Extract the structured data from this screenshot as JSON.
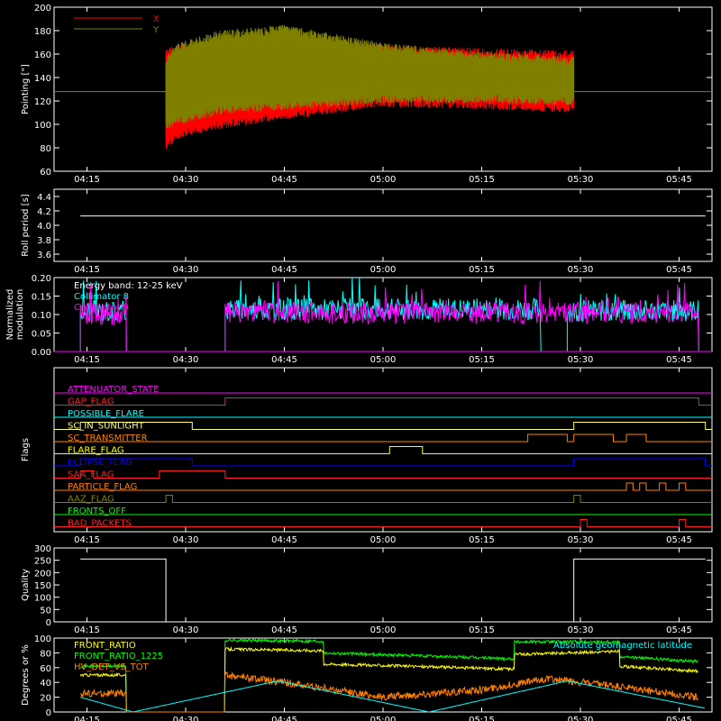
{
  "time_axis": {
    "ticks": [
      "04:15",
      "04:30",
      "04:45",
      "05:00",
      "05:15",
      "05:30",
      "05:45"
    ],
    "start_min": 250,
    "end_min": 350
  },
  "chart_data": [
    {
      "id": "pointing",
      "type": "line",
      "ylabel": "Pointing [\"]",
      "ylim": [
        60,
        200
      ],
      "yticks": [
        "60",
        "80",
        "100",
        "120",
        "140",
        "160",
        "180",
        "200"
      ],
      "legend": [
        {
          "name": "X",
          "color": "#ff0000"
        },
        {
          "name": "Y",
          "color": "#808000"
        }
      ],
      "series": [
        {
          "name": "X",
          "color": "#ff0000",
          "x": [
            "04:27",
            "04:29",
            "04:35",
            "04:45",
            "05:00",
            "05:15",
            "05:29"
          ],
          "upper": [
            165,
            168,
            172,
            172,
            168,
            165,
            163
          ],
          "lower": [
            78,
            88,
            96,
            104,
            115,
            113,
            110
          ]
        },
        {
          "name": "Y",
          "color": "#808000",
          "x": [
            "04:27",
            "04:29",
            "04:35",
            "04:45",
            "05:00",
            "05:15",
            "05:29"
          ],
          "upper": [
            160,
            170,
            180,
            185,
            170,
            162,
            158
          ],
          "lower": [
            95,
            100,
            108,
            112,
            118,
            118,
            116
          ]
        }
      ],
      "baseline": 128
    },
    {
      "id": "roll",
      "type": "line",
      "ylabel": "Roll period [s]",
      "ylim": [
        3.5,
        4.5
      ],
      "yticks": [
        "3.6",
        "3.8",
        "4.0",
        "4.2",
        "4.4"
      ],
      "series": [
        {
          "name": "",
          "color": "#ffffff",
          "x": [
            "04:14",
            "05:49"
          ],
          "y": [
            4.13,
            4.13
          ]
        }
      ]
    },
    {
      "id": "modulation",
      "type": "line",
      "ylabel": "Normalized modulation",
      "ylim": [
        0,
        0.2
      ],
      "yticks": [
        "0.00",
        "0.05",
        "0.10",
        "0.15",
        "0.20"
      ],
      "annotation": "Energy band: 12-25 keV",
      "legend": [
        {
          "name": "Collimator 8",
          "color": "#00ffff"
        },
        {
          "name": "Collimator 9",
          "color": "#ff00ff"
        }
      ],
      "series": [
        {
          "name": "Collimator 8",
          "color": "#00ffff",
          "segments": [
            [
              "04:14",
              "04:21",
              0.11
            ],
            [
              "04:36",
              "05:24",
              0.115
            ],
            [
              "05:28",
              "05:48",
              0.11
            ]
          ]
        },
        {
          "name": "Collimator 9",
          "color": "#ff00ff",
          "segments": [
            [
              "04:14",
              "04:21",
              0.1
            ],
            [
              "04:36",
              "05:48",
              0.105
            ]
          ]
        }
      ]
    },
    {
      "id": "flags",
      "type": "line",
      "ylabel": "Flags",
      "rows": [
        {
          "name": "ATTENUATOR_STATE",
          "color": "#ff00ff",
          "steps": []
        },
        {
          "name": "GAP_FLAG",
          "color": "#ff2020",
          "steps": [
            [
              "04:36",
              "05:48"
            ]
          ]
        },
        {
          "name": "POSSIBLE_FLARE",
          "color": "#00ffff",
          "steps": []
        },
        {
          "name": "SC_IN_SUNLIGHT",
          "color": "#ffff80",
          "steps": [
            [
              "04:14",
              "04:31"
            ],
            [
              "05:29",
              "05:49"
            ]
          ]
        },
        {
          "name": "SC_TRANSMITTER",
          "color": "#ff8000",
          "steps": [
            [
              "05:22",
              "05:28"
            ],
            [
              "05:29",
              "05:35"
            ],
            [
              "05:37",
              "05:40"
            ]
          ]
        },
        {
          "name": "FLARE_FLAG",
          "color": "#ffff00",
          "steps": [
            [
              "05:01",
              "05:06"
            ]
          ]
        },
        {
          "name": "ECLIPSE_FLAG",
          "color": "#0000ff",
          "steps": [
            [
              "04:14",
              "04:31"
            ],
            [
              "05:29",
              "05:49"
            ]
          ]
        },
        {
          "name": "SAA_FLAG",
          "color": "#ff2020",
          "steps": [
            [
              "04:14",
              "04:16"
            ],
            [
              "04:26",
              "04:36"
            ]
          ]
        },
        {
          "name": "PARTICLE_FLAG",
          "color": "#ff8000",
          "steps": [
            [
              "05:37",
              "05:38"
            ],
            [
              "05:39",
              "05:40"
            ],
            [
              "05:42",
              "05:43"
            ],
            [
              "05:45",
              "05:46"
            ]
          ]
        },
        {
          "name": "AAZ_FLAG",
          "color": "#808000",
          "steps": [
            [
              "04:27",
              "04:28"
            ],
            [
              "05:29",
              "05:30"
            ]
          ]
        },
        {
          "name": "FRONTS_OFF",
          "color": "#00ff00",
          "steps": []
        },
        {
          "name": "BAD_PACKETS",
          "color": "#ff2020",
          "steps": [
            [
              "05:30",
              "05:31"
            ],
            [
              "05:45",
              "05:46"
            ]
          ]
        }
      ]
    },
    {
      "id": "quality",
      "type": "line",
      "ylabel": "Quality",
      "ylim": [
        0,
        300
      ],
      "yticks": [
        "0",
        "50",
        "100",
        "150",
        "200",
        "250",
        "300"
      ],
      "series": [
        {
          "name": "",
          "color": "#ffffff",
          "x": [
            "04:14",
            "04:27",
            "04:27",
            "05:29",
            "05:29",
            "05:49"
          ],
          "y": [
            255,
            255,
            0,
            0,
            255,
            255
          ]
        }
      ]
    },
    {
      "id": "fronts",
      "type": "line",
      "ylabel": "Degrees or %",
      "ylim": [
        0,
        100
      ],
      "yticks": [
        "0",
        "20",
        "40",
        "60",
        "80",
        "100"
      ],
      "legend": [
        {
          "name": "FRONT_RATIO",
          "color": "#ffff00"
        },
        {
          "name": "FRONT_RATIO_1225",
          "color": "#00ff00"
        },
        {
          "name": "HV_DET_VS_TOT",
          "color": "#ff8000"
        },
        {
          "name": "Absolute geomagnetic latitude",
          "color": "#00ffff"
        }
      ],
      "series": [
        {
          "name": "FRONT_RATIO_1225",
          "color": "#00ff00",
          "x": [
            "04:14",
            "04:21",
            "04:21",
            "04:36",
            "04:36",
            "04:51",
            "04:51",
            "05:20",
            "05:20",
            "05:36",
            "05:36",
            "05:48",
            "05:48"
          ],
          "y": [
            62,
            62,
            0,
            0,
            97,
            96,
            80,
            72,
            95,
            95,
            75,
            68,
            0
          ]
        },
        {
          "name": "FRONT_RATIO",
          "color": "#ffff00",
          "x": [
            "04:14",
            "04:21",
            "04:21",
            "04:36",
            "04:36",
            "04:51",
            "04:51",
            "05:20",
            "05:20",
            "05:36",
            "05:36",
            "05:48",
            "05:48"
          ],
          "y": [
            50,
            50,
            0,
            0,
            85,
            83,
            65,
            58,
            78,
            82,
            62,
            55,
            0
          ]
        },
        {
          "name": "HV_DET_VS_TOT",
          "color": "#ff8000",
          "x": [
            "04:14",
            "04:21",
            "04:21",
            "04:36",
            "04:36",
            "04:45",
            "05:00",
            "05:15",
            "05:25",
            "05:35",
            "05:48",
            "05:48"
          ],
          "y": [
            25,
            25,
            0,
            0,
            50,
            40,
            20,
            30,
            45,
            35,
            20,
            0
          ]
        },
        {
          "name": "Absolute geomagnetic latitude",
          "color": "#00ffff",
          "x": [
            "04:14",
            "04:22",
            "04:44",
            "05:07",
            "05:28",
            "05:49"
          ],
          "y": [
            20,
            0,
            42,
            0,
            42,
            5
          ]
        }
      ]
    }
  ]
}
